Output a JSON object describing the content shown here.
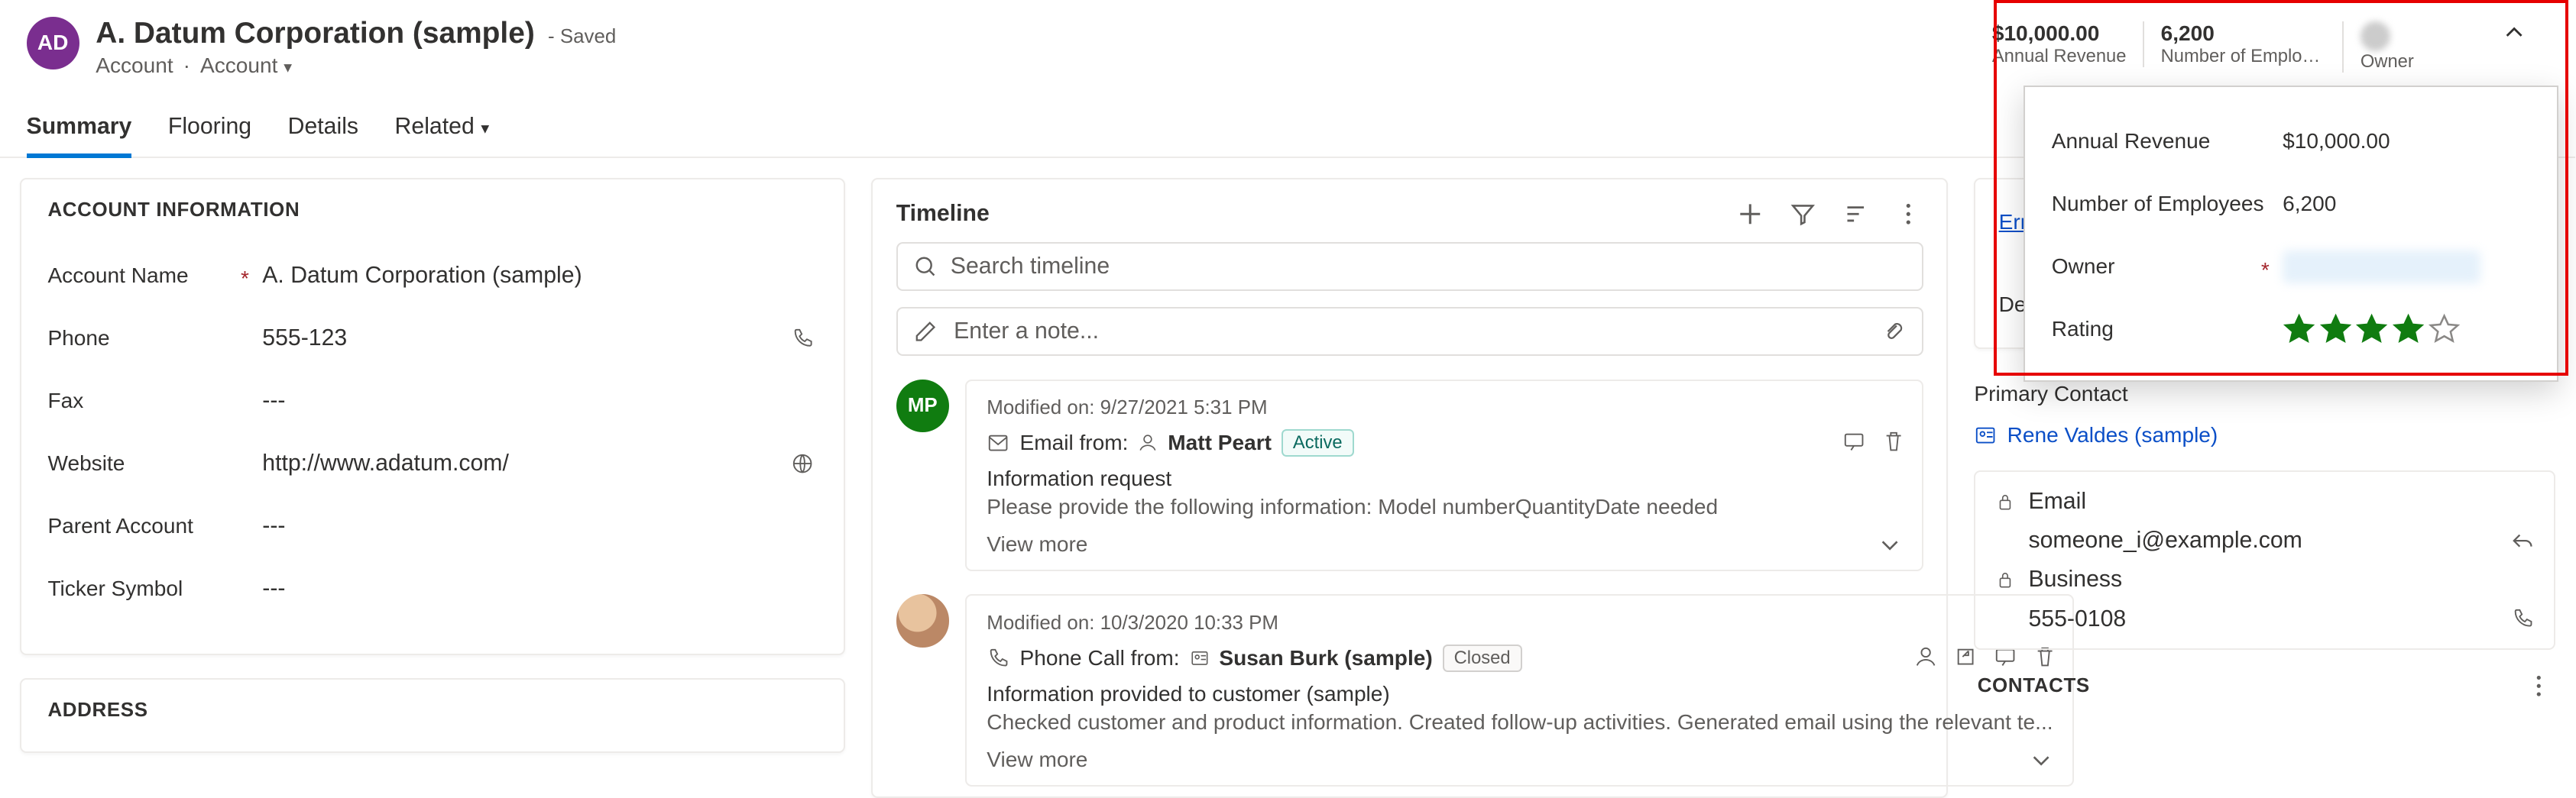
{
  "header": {
    "avatar_initials": "AD",
    "title": "A. Datum Corporation (sample)",
    "saved_suffix": "- Saved",
    "entity": "Account",
    "form": "Account"
  },
  "key_fields": {
    "revenue_value": "$10,000.00",
    "revenue_label": "Annual Revenue",
    "employees_value": "6,200",
    "employees_label": "Number of Employees",
    "owner_label": "Owner"
  },
  "tabs": [
    "Summary",
    "Flooring",
    "Details",
    "Related"
  ],
  "active_tab": "Summary",
  "account_info": {
    "title": "ACCOUNT INFORMATION",
    "fields": {
      "name_label": "Account Name",
      "name_value": "A. Datum Corporation (sample)",
      "phone_label": "Phone",
      "phone_value": "555-123",
      "fax_label": "Fax",
      "fax_value": "---",
      "website_label": "Website",
      "website_value": "http://www.adatum.com/",
      "parent_label": "Parent Account",
      "parent_value": "---",
      "ticker_label": "Ticker Symbol",
      "ticker_value": "---"
    }
  },
  "address_title": "ADDRESS",
  "timeline": {
    "title": "Timeline",
    "search_placeholder": "Search timeline",
    "note_placeholder": "Enter a note...",
    "items": [
      {
        "avatar": "MP",
        "modified": "Modified on: 9/27/2021 5:31 PM",
        "kind_label": "Email from:",
        "from": "Matt Peart",
        "status": "Active",
        "subject": "Information request",
        "snippet": "Please provide the following information:   Model numberQuantityDate needed",
        "view_more": "View more"
      },
      {
        "avatar": "",
        "modified": "Modified on: 10/3/2020 10:33 PM",
        "kind_label": "Phone Call from:",
        "from": "Susan Burk (sample)",
        "status": "Closed",
        "subject": "Information provided to customer (sample)",
        "snippet": "Checked customer and product information. Created follow-up activities. Generated email using the relevant te...",
        "view_more": "View more"
      }
    ]
  },
  "right": {
    "error_text": "Error loadi",
    "description_label": "Descrip",
    "primary_contact_label": "Primary Contact",
    "primary_contact_value": "Rene Valdes (sample)",
    "email_label": "Email",
    "email_value": "someone_i@example.com",
    "business_label": "Business",
    "business_value": "555-0108",
    "contacts_title": "CONTACTS"
  },
  "flyout": {
    "revenue_label": "Annual Revenue",
    "revenue_value": "$10,000.00",
    "employees_label": "Number of Employees",
    "employees_value": "6,200",
    "owner_label": "Owner",
    "rating_label": "Rating",
    "rating_value": 4,
    "rating_max": 5
  }
}
